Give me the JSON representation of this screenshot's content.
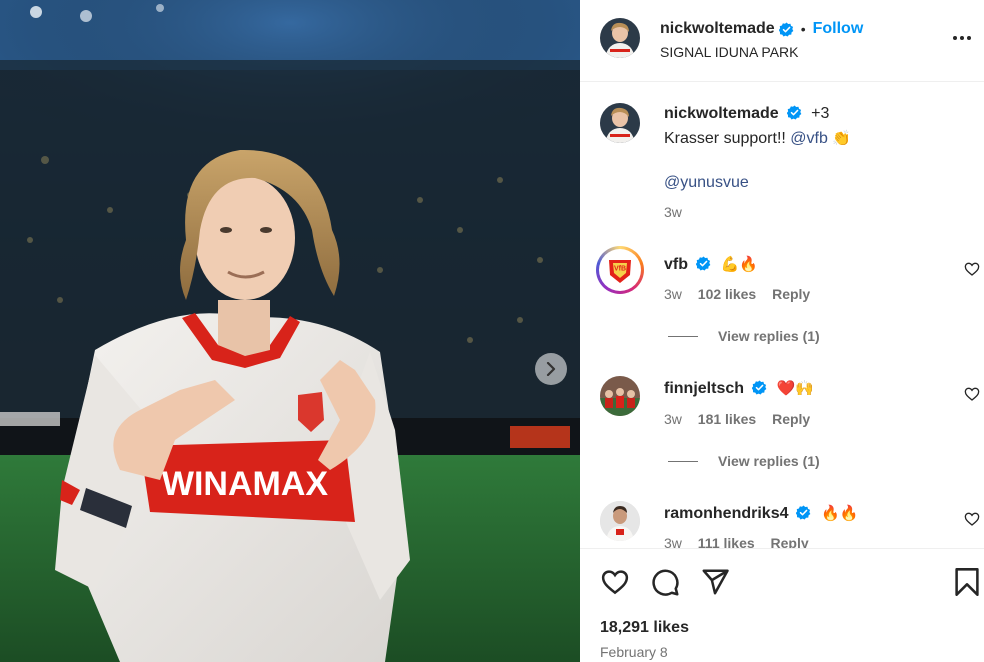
{
  "post": {
    "author": "nickwoltemade",
    "follow_label": "Follow",
    "dot": "•",
    "location": "SIGNAL IDUNA PARK",
    "jersey_text": "WINAMAX"
  },
  "caption": {
    "username": "nickwoltemade",
    "coauthors": "+3",
    "text": "Krasser support!!",
    "mention1": "@vfb",
    "emoji": "👏",
    "mention2": "@yunusvue",
    "time": "3w"
  },
  "comments": [
    {
      "username": "vfb",
      "emoji": "💪🔥",
      "time": "3w",
      "likes": "102 likes",
      "reply_label": "Reply",
      "view_replies": "View replies (1)"
    },
    {
      "username": "finnjeltsch",
      "emoji": "❤️🙌",
      "time": "3w",
      "likes": "181 likes",
      "reply_label": "Reply",
      "view_replies": "View replies (1)"
    },
    {
      "username": "ramonhendriks4",
      "emoji": "🔥🔥",
      "time": "3w",
      "likes": "111 likes",
      "reply_label": "Reply"
    }
  ],
  "footer": {
    "likes": "18,291 likes",
    "date": "February 8"
  },
  "colors": {
    "accent": "#0095f6",
    "verified": "#0095f6",
    "text": "#262626",
    "secondary": "#737373"
  }
}
